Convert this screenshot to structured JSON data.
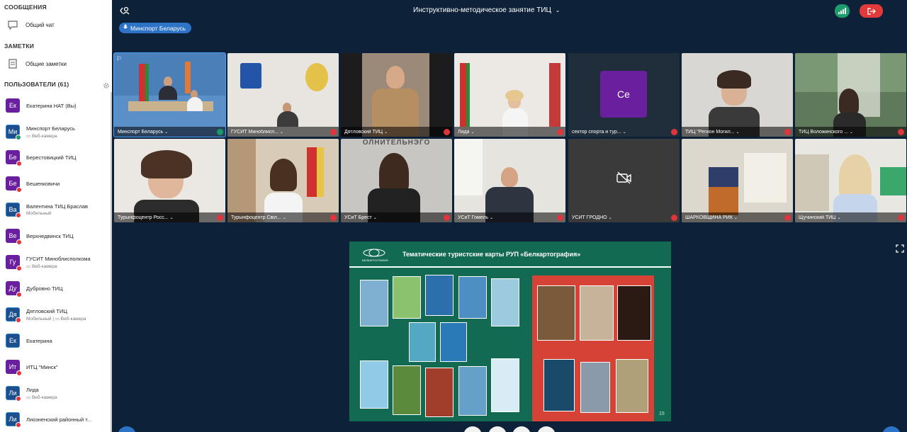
{
  "sidebar": {
    "messages_title": "СООБЩЕНИЯ",
    "public_chat": "Общий чат",
    "notes_title": "ЗАМЕТКИ",
    "shared_notes": "Общие заметки",
    "users_title": "ПОЛЬЗОВАТЕЛИ (61)",
    "users": [
      {
        "initials": "Ек",
        "name": "Екатерина НАТ (Вы)",
        "sub": "",
        "muted": false,
        "style": "purple"
      },
      {
        "initials": "Ми",
        "name": "Минспорт Беларусь",
        "sub": "▭ Веб-камера",
        "muted": false,
        "style": "blue"
      },
      {
        "initials": "Бе",
        "name": "Берестовицкий ТИЦ",
        "sub": "",
        "muted": true,
        "style": "purple"
      },
      {
        "initials": "Бе",
        "name": "Бешенковичи",
        "sub": "",
        "muted": true,
        "style": "purple"
      },
      {
        "initials": "Ва",
        "name": "Валентина ТИЦ Браслав",
        "sub": "Мобильный",
        "muted": true,
        "style": "blue"
      },
      {
        "initials": "Ве",
        "name": "Верхнедвинск ТИЦ",
        "sub": "",
        "muted": true,
        "style": "purple"
      },
      {
        "initials": "Гу",
        "name": "ГУСИТ Миноблисполкома",
        "sub": "▭ Веб-камера",
        "muted": true,
        "style": "purple"
      },
      {
        "initials": "Ду",
        "name": "Дубровно ТИЦ",
        "sub": "",
        "muted": true,
        "style": "purple"
      },
      {
        "initials": "Дя",
        "name": "Дятловский ТИЦ",
        "sub": "Мобильный | ▭ Веб-камера",
        "muted": true,
        "style": "blue"
      },
      {
        "initials": "Ек",
        "name": "Екатерина",
        "sub": "",
        "muted": false,
        "style": "blue"
      },
      {
        "initials": "Ит",
        "name": "ИТЦ \"Минск\"",
        "sub": "",
        "muted": true,
        "style": "purple"
      },
      {
        "initials": "Ли",
        "name": "Лида",
        "sub": "▭ Веб-камера",
        "muted": true,
        "style": "blue"
      },
      {
        "initials": "Ли",
        "name": "Лиозненский районный т...",
        "sub": "",
        "muted": true,
        "style": "blue"
      }
    ]
  },
  "topbar": {
    "meeting_title": "Инструктивно-методическое занятие ТИЦ",
    "presenter_pill": "Минспорт Беларусь"
  },
  "tiles": [
    {
      "name": "Минспорт Беларусь",
      "mic": "green",
      "active": true
    },
    {
      "name": "ГУСИТ Миноблисп...",
      "mic": "red"
    },
    {
      "name": "Дятловский ТИЦ",
      "mic": "red"
    },
    {
      "name": "Лида",
      "mic": "red"
    },
    {
      "name": "сектор спорта и тур...",
      "mic": "red",
      "initials": "Се"
    },
    {
      "name": "ТИЦ \"Регион Могил...",
      "mic": "red"
    },
    {
      "name": "ТИЦ Воложинского ...",
      "mic": "red"
    },
    {
      "name": "Турынфоцентр Росс...",
      "mic": "red"
    },
    {
      "name": "Турынфоцентр Свіл...",
      "mic": "red"
    },
    {
      "name": "УСиТ Брест",
      "mic": "red"
    },
    {
      "name": "УСиТ Гомель",
      "mic": "red"
    },
    {
      "name": "УСИТ ГРОДНО",
      "mic": "red"
    },
    {
      "name": "ШАРКОВЩИНА РИК",
      "mic": "red"
    },
    {
      "name": "Щучинский ТИЦ",
      "mic": "red"
    }
  ],
  "slide": {
    "title": "Тематические туристские карты РУП «Белкартография»",
    "logo_text": "БЕЛКАРТОГРАФИЯ",
    "page_number": "15",
    "tile5_wall_text": "ОЛНИТЕЛЬНЭГО"
  },
  "colors": {
    "background": "#0d2238",
    "slide_green": "#136a52",
    "slide_red": "#d64236",
    "accent_blue": "#2d73c7",
    "leave_red": "#e23a3a",
    "avatar_purple": "#6a1f9e"
  }
}
